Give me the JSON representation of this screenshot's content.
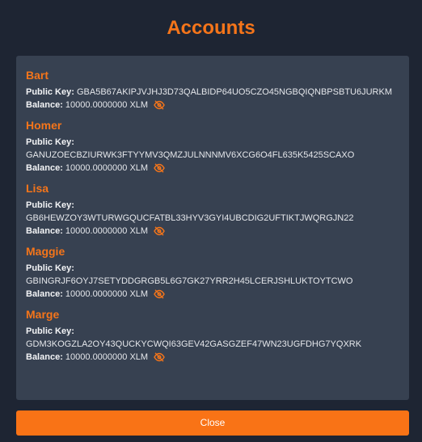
{
  "modal": {
    "title": "Accounts",
    "close_label": "Close"
  },
  "labels": {
    "public_key": "Public Key:",
    "balance": "Balance:"
  },
  "accounts": [
    {
      "name": "Bart",
      "public_key": "GBA5B67AKIPJVJHJ3D73QALBIDP64UO5CZO45NGBQIQNBPSBTU6JURKM",
      "balance": "10000.0000000 XLM",
      "key_inline": true
    },
    {
      "name": "Homer",
      "public_key": "GANUZOECBZIURWK3FTYYMV3QMZJULNNNMV6XCG6O4FL635K5425SCAXO",
      "balance": "10000.0000000 XLM",
      "key_inline": false
    },
    {
      "name": "Lisa",
      "public_key": "GB6HEWZOY3WTURWGQUCFATBL33HYV3GYI4UBCDIG2UFTIKTJWQRGJN22",
      "balance": "10000.0000000 XLM",
      "key_inline": false
    },
    {
      "name": "Maggie",
      "public_key": "GBINGRJF6OYJ7SETYDDGRGB5L6G7GK27YRR2H45LCERJSHLUKTOYTCWO",
      "balance": "10000.0000000 XLM",
      "key_inline": false
    },
    {
      "name": "Marge",
      "public_key": "GDM3KOGZLA2OY43QUCKYCWQI63GEV42GASGZEF47WN23UGFDHG7YQXRK",
      "balance": "10000.0000000 XLM",
      "key_inline": false
    }
  ],
  "icons": {
    "toggle_visibility": "eye-slash-icon"
  },
  "colors": {
    "accent": "#f5751a",
    "background": "#1e2533",
    "panel": "#374151",
    "button": "#f97316"
  }
}
